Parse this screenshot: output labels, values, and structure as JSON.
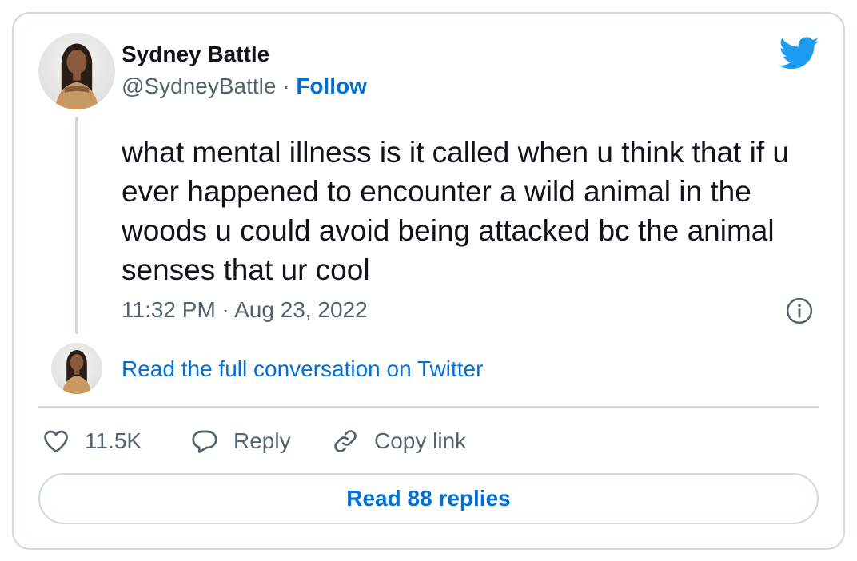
{
  "author": {
    "display_name": "Sydney Battle",
    "handle": "@SydneyBattle",
    "separator": " · ",
    "follow_label": "Follow"
  },
  "tweet": {
    "text": "what mental illness is it called when u think that if u ever happened to encounter a wild animal in the woods u could avoid being attacked bc the animal senses that ur cool",
    "timestamp": "11:32 PM · Aug 23, 2022"
  },
  "conversation": {
    "read_full_label": "Read the full conversation on Twitter"
  },
  "actions": {
    "like_count": "11.5K",
    "reply_label": "Reply",
    "copy_link_label": "Copy link"
  },
  "footer": {
    "read_replies_label": "Read 88 replies"
  },
  "colors": {
    "brand_blue": "#1d9bf0",
    "link_blue": "#006fd6",
    "text_primary": "#0f1419",
    "text_secondary": "#536471",
    "border": "#cfd9de"
  },
  "icons": [
    "twitter-bird-icon",
    "info-icon",
    "heart-icon",
    "reply-bubble-icon",
    "link-icon"
  ]
}
